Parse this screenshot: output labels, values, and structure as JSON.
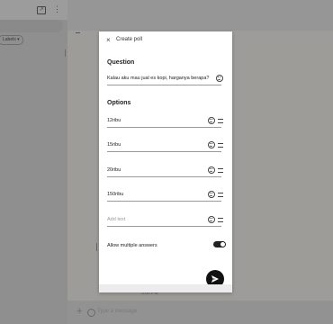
{
  "background": {
    "labels_chip": "Labels",
    "labels_chip_arrow": "▾",
    "plus_symbol": "+",
    "type_message_placeholder": "Type a message",
    "timestamp_hint": "3:00 PM",
    "icons": [
      "open-in-new-icon",
      "more-vert-icon",
      "plus-icon",
      "emoji-icon"
    ]
  },
  "dialog": {
    "close_symbol": "×",
    "title": "Create poll",
    "question_section": "Question",
    "question_text": "Kalau aku mau jual es kopi, harganya berapa?",
    "options_section": "Options",
    "options": [
      "12ribu",
      "15ribu",
      "20ribu",
      "150ribu"
    ],
    "add_text_placeholder": "Add text",
    "allow_multiple_label": "Allow multiple answers",
    "allow_multiple_enabled": true,
    "icons": [
      "close-icon",
      "emoji-icon",
      "drag-handle-icon",
      "send-icon"
    ]
  },
  "colors": {
    "toggle_on": "#222222",
    "send_button": "#111111",
    "overlay": "#9a9a9a"
  }
}
